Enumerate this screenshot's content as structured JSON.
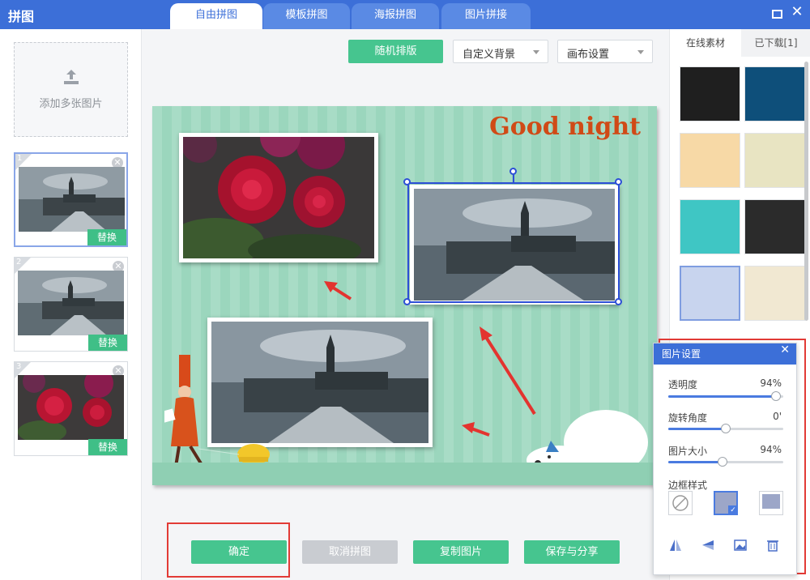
{
  "app": {
    "title": "拼图"
  },
  "tabs": [
    {
      "label": "自由拼图",
      "active": true
    },
    {
      "label": "模板拼图",
      "active": false
    },
    {
      "label": "海报拼图",
      "active": false
    },
    {
      "label": "图片拼接",
      "active": false
    }
  ],
  "left_panel": {
    "add_label": "添加多张图片",
    "thumbs": [
      {
        "num": "1",
        "replace": "替换",
        "scene": "church"
      },
      {
        "num": "2",
        "replace": "替换",
        "scene": "church"
      },
      {
        "num": "3",
        "replace": "替换",
        "scene": "roses"
      }
    ]
  },
  "toolbar": {
    "random_label": "随机排版",
    "custom_bg_label": "自定义背景",
    "canvas_settings_label": "画布设置"
  },
  "canvas": {
    "greeting": "Good night"
  },
  "bottom": {
    "confirm_label": "确定",
    "cancel_label": "取消拼图",
    "copy_label": "复制图片",
    "save_label": "保存与分享"
  },
  "right_panel": {
    "tab_online": "在线素材",
    "tab_downloaded": "已下载[1]"
  },
  "popup": {
    "title": "图片设置",
    "opacity_label": "透明度",
    "opacity_value": "94%",
    "opacity_level": 0.94,
    "rotation_label": "旋转角度",
    "rotation_value": "0'",
    "rotation_level": 0.5,
    "size_label": "图片大小",
    "size_value": "94%",
    "size_level": 0.47,
    "border_label": "边框样式"
  },
  "colors": {
    "brand_blue": "#3c6fd8",
    "accent_green": "#46c58f",
    "highlight_red": "#e23b36"
  }
}
